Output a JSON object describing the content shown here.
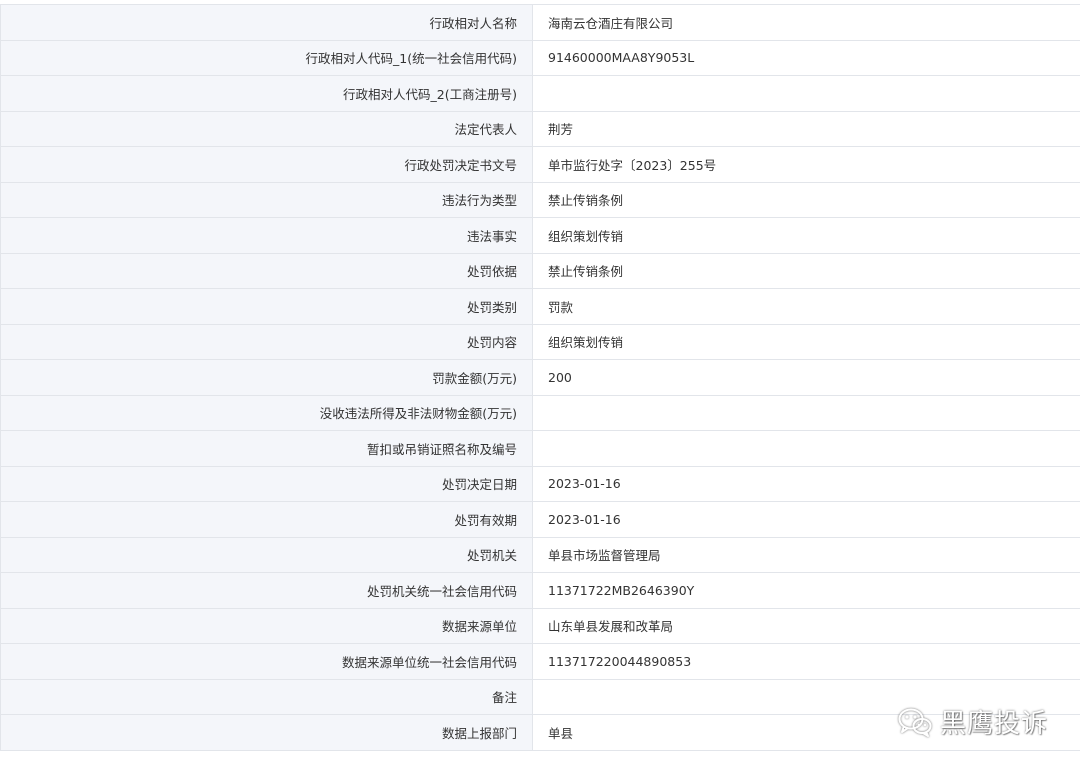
{
  "rows": [
    {
      "label": "行政相对人名称",
      "value": "海南云仓酒庄有限公司"
    },
    {
      "label": "行政相对人代码_1(统一社会信用代码)",
      "value": "91460000MAA8Y9053L"
    },
    {
      "label": "行政相对人代码_2(工商注册号)",
      "value": ""
    },
    {
      "label": "法定代表人",
      "value": "荆芳"
    },
    {
      "label": "行政处罚决定书文号",
      "value": "单市监行处字〔2023〕255号"
    },
    {
      "label": "违法行为类型",
      "value": "禁止传销条例"
    },
    {
      "label": "违法事实",
      "value": "组织策划传销"
    },
    {
      "label": "处罚依据",
      "value": "禁止传销条例"
    },
    {
      "label": "处罚类别",
      "value": "罚款"
    },
    {
      "label": "处罚内容",
      "value": "组织策划传销"
    },
    {
      "label": "罚款金额(万元)",
      "value": "200"
    },
    {
      "label": "没收违法所得及非法财物金额(万元)",
      "value": ""
    },
    {
      "label": "暂扣或吊销证照名称及编号",
      "value": ""
    },
    {
      "label": "处罚决定日期",
      "value": "2023-01-16"
    },
    {
      "label": "处罚有效期",
      "value": "2023-01-16"
    },
    {
      "label": "处罚机关",
      "value": "单县市场监督管理局"
    },
    {
      "label": "处罚机关统一社会信用代码",
      "value": "11371722MB2646390Y"
    },
    {
      "label": "数据来源单位",
      "value": "山东单县发展和改革局"
    },
    {
      "label": "数据来源单位统一社会信用代码",
      "value": "113717220044890853"
    },
    {
      "label": "备注",
      "value": ""
    },
    {
      "label": "数据上报部门",
      "value": "单县"
    }
  ],
  "watermark": {
    "text": "黑鹰投诉",
    "icon": "wechat-icon"
  },
  "colors": {
    "label_bg": "#f4f6fa",
    "border": "#e2e5ea",
    "text": "#333333"
  }
}
